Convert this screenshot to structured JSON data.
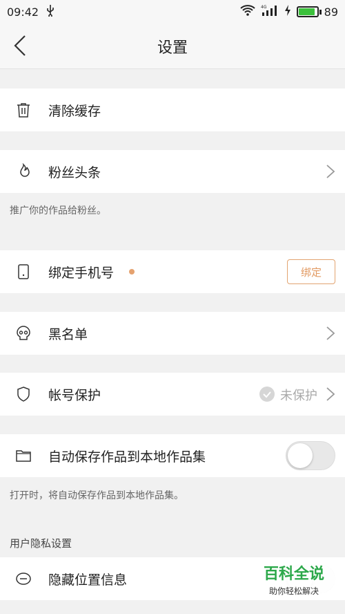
{
  "status_bar": {
    "time": "09:42",
    "usb_icon": "usb-icon",
    "network": "4G",
    "battery": "89",
    "battery_level": 0.89
  },
  "nav": {
    "title": "设置",
    "back_icon": "back-arrow-icon"
  },
  "rows": {
    "clear_cache": {
      "label": "清除缓存",
      "icon": "trash-icon"
    },
    "fan_headlines": {
      "label": "粉丝头条",
      "icon": "flame-icon",
      "note": "推广你的作品给粉丝。"
    },
    "bind_phone": {
      "label": "绑定手机号",
      "icon": "phone-icon",
      "button": "绑定",
      "dot_color": "#e5a26f"
    },
    "blacklist": {
      "label": "黑名单",
      "icon": "skull-icon"
    },
    "account_protect": {
      "label": "帐号保护",
      "icon": "shield-icon",
      "status": "未保护"
    },
    "auto_save": {
      "label": "自动保存作品到本地作品集",
      "icon": "folder-icon",
      "toggle_on": false,
      "note": "打开时，将自动保存作品到本地作品集。"
    }
  },
  "privacy": {
    "header": "用户隐私设置",
    "hide_location": {
      "label": "隐藏位置信息",
      "icon": "location-hide-icon",
      "toggle_on": false
    }
  },
  "watermark": {
    "main": "百科全说",
    "sub": "助你轻松解决"
  },
  "accent_color": "#e2a36f"
}
